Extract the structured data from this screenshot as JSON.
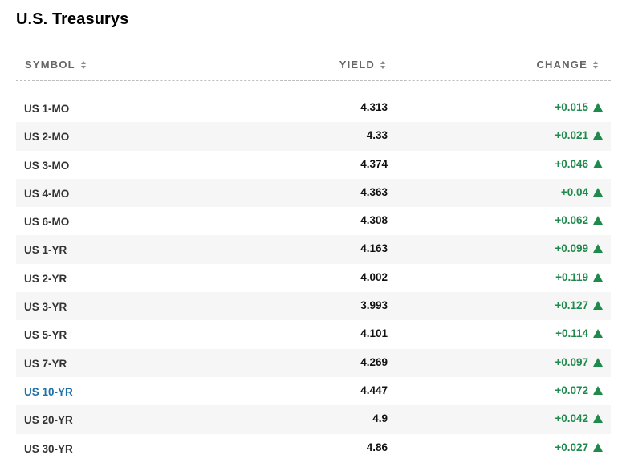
{
  "title": "U.S. Treasurys",
  "colors": {
    "positive": "#1f8a4c",
    "link": "#1f6fa8",
    "header_text": "#666666"
  },
  "columns": {
    "symbol": "SYMBOL",
    "yield": "YIELD",
    "change": "CHANGE"
  },
  "rows": [
    {
      "symbol": "US 1-MO",
      "yield": "4.313",
      "change": "+0.015"
    },
    {
      "symbol": "US 2-MO",
      "yield": "4.33",
      "change": "+0.021"
    },
    {
      "symbol": "US 3-MO",
      "yield": "4.374",
      "change": "+0.046"
    },
    {
      "symbol": "US 4-MO",
      "yield": "4.363",
      "change": "+0.04"
    },
    {
      "symbol": "US 6-MO",
      "yield": "4.308",
      "change": "+0.062"
    },
    {
      "symbol": "US 1-YR",
      "yield": "4.163",
      "change": "+0.099"
    },
    {
      "symbol": "US 2-YR",
      "yield": "4.002",
      "change": "+0.119"
    },
    {
      "symbol": "US 3-YR",
      "yield": "3.993",
      "change": "+0.127"
    },
    {
      "symbol": "US 5-YR",
      "yield": "4.101",
      "change": "+0.114"
    },
    {
      "symbol": "US 7-YR",
      "yield": "4.269",
      "change": "+0.097"
    },
    {
      "symbol": "US 10-YR",
      "yield": "4.447",
      "change": "+0.072"
    },
    {
      "symbol": "US 20-YR",
      "yield": "4.9",
      "change": "+0.042"
    },
    {
      "symbol": "US 30-YR",
      "yield": "4.86",
      "change": "+0.027"
    }
  ]
}
